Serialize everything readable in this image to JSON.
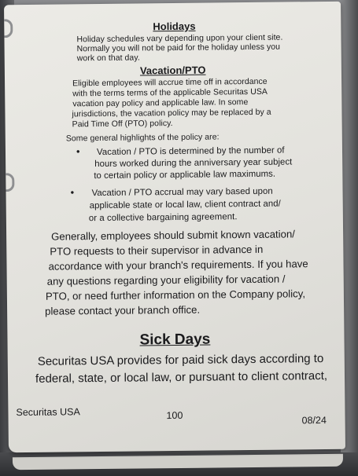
{
  "holidays": {
    "heading": "Holidays",
    "lines": [
      "Holiday schedules vary depending upon your client site.",
      "Normally you will not be paid for the holiday unless you",
      "work on that day."
    ]
  },
  "vacation": {
    "heading": "Vacation/PTO",
    "intro_lines": [
      "Eligible employees will accrue time off in accordance",
      "with the terms terms of the applicable Securitas USA",
      "vacation pay policy and applicable law. In some",
      "jurisdictions, the vacation policy may be replaced by a",
      "Paid Time Off (PTO) policy."
    ],
    "highlights_intro": "Some general highlights of the policy are:",
    "bullet1_lines": [
      "Vacation / PTO is determined by the number of",
      "hours worked during the anniversary year subject",
      "to certain policy or applicable law maximums."
    ],
    "bullet2_lines": [
      "Vacation / PTO accrual may vary based upon",
      "applicable state or local law, client contract and/",
      "or a collective bargaining agreement."
    ],
    "closing_lines": [
      "Generally, employees should submit known vacation/",
      "PTO requests to their supervisor in advance in",
      "accordance with your branch's requirements. If you have",
      "any questions regarding your eligibility for vacation /",
      "PTO, or need further information on the Company policy,",
      "please contact your branch office."
    ]
  },
  "sick_days": {
    "heading": "Sick Days",
    "lines": [
      "Securitas USA provides for paid sick days according to",
      "federal, state, or local law, or pursuant to client contract,"
    ]
  },
  "footer": {
    "company": "Securitas USA",
    "page_number": "100",
    "date": "08/24"
  }
}
